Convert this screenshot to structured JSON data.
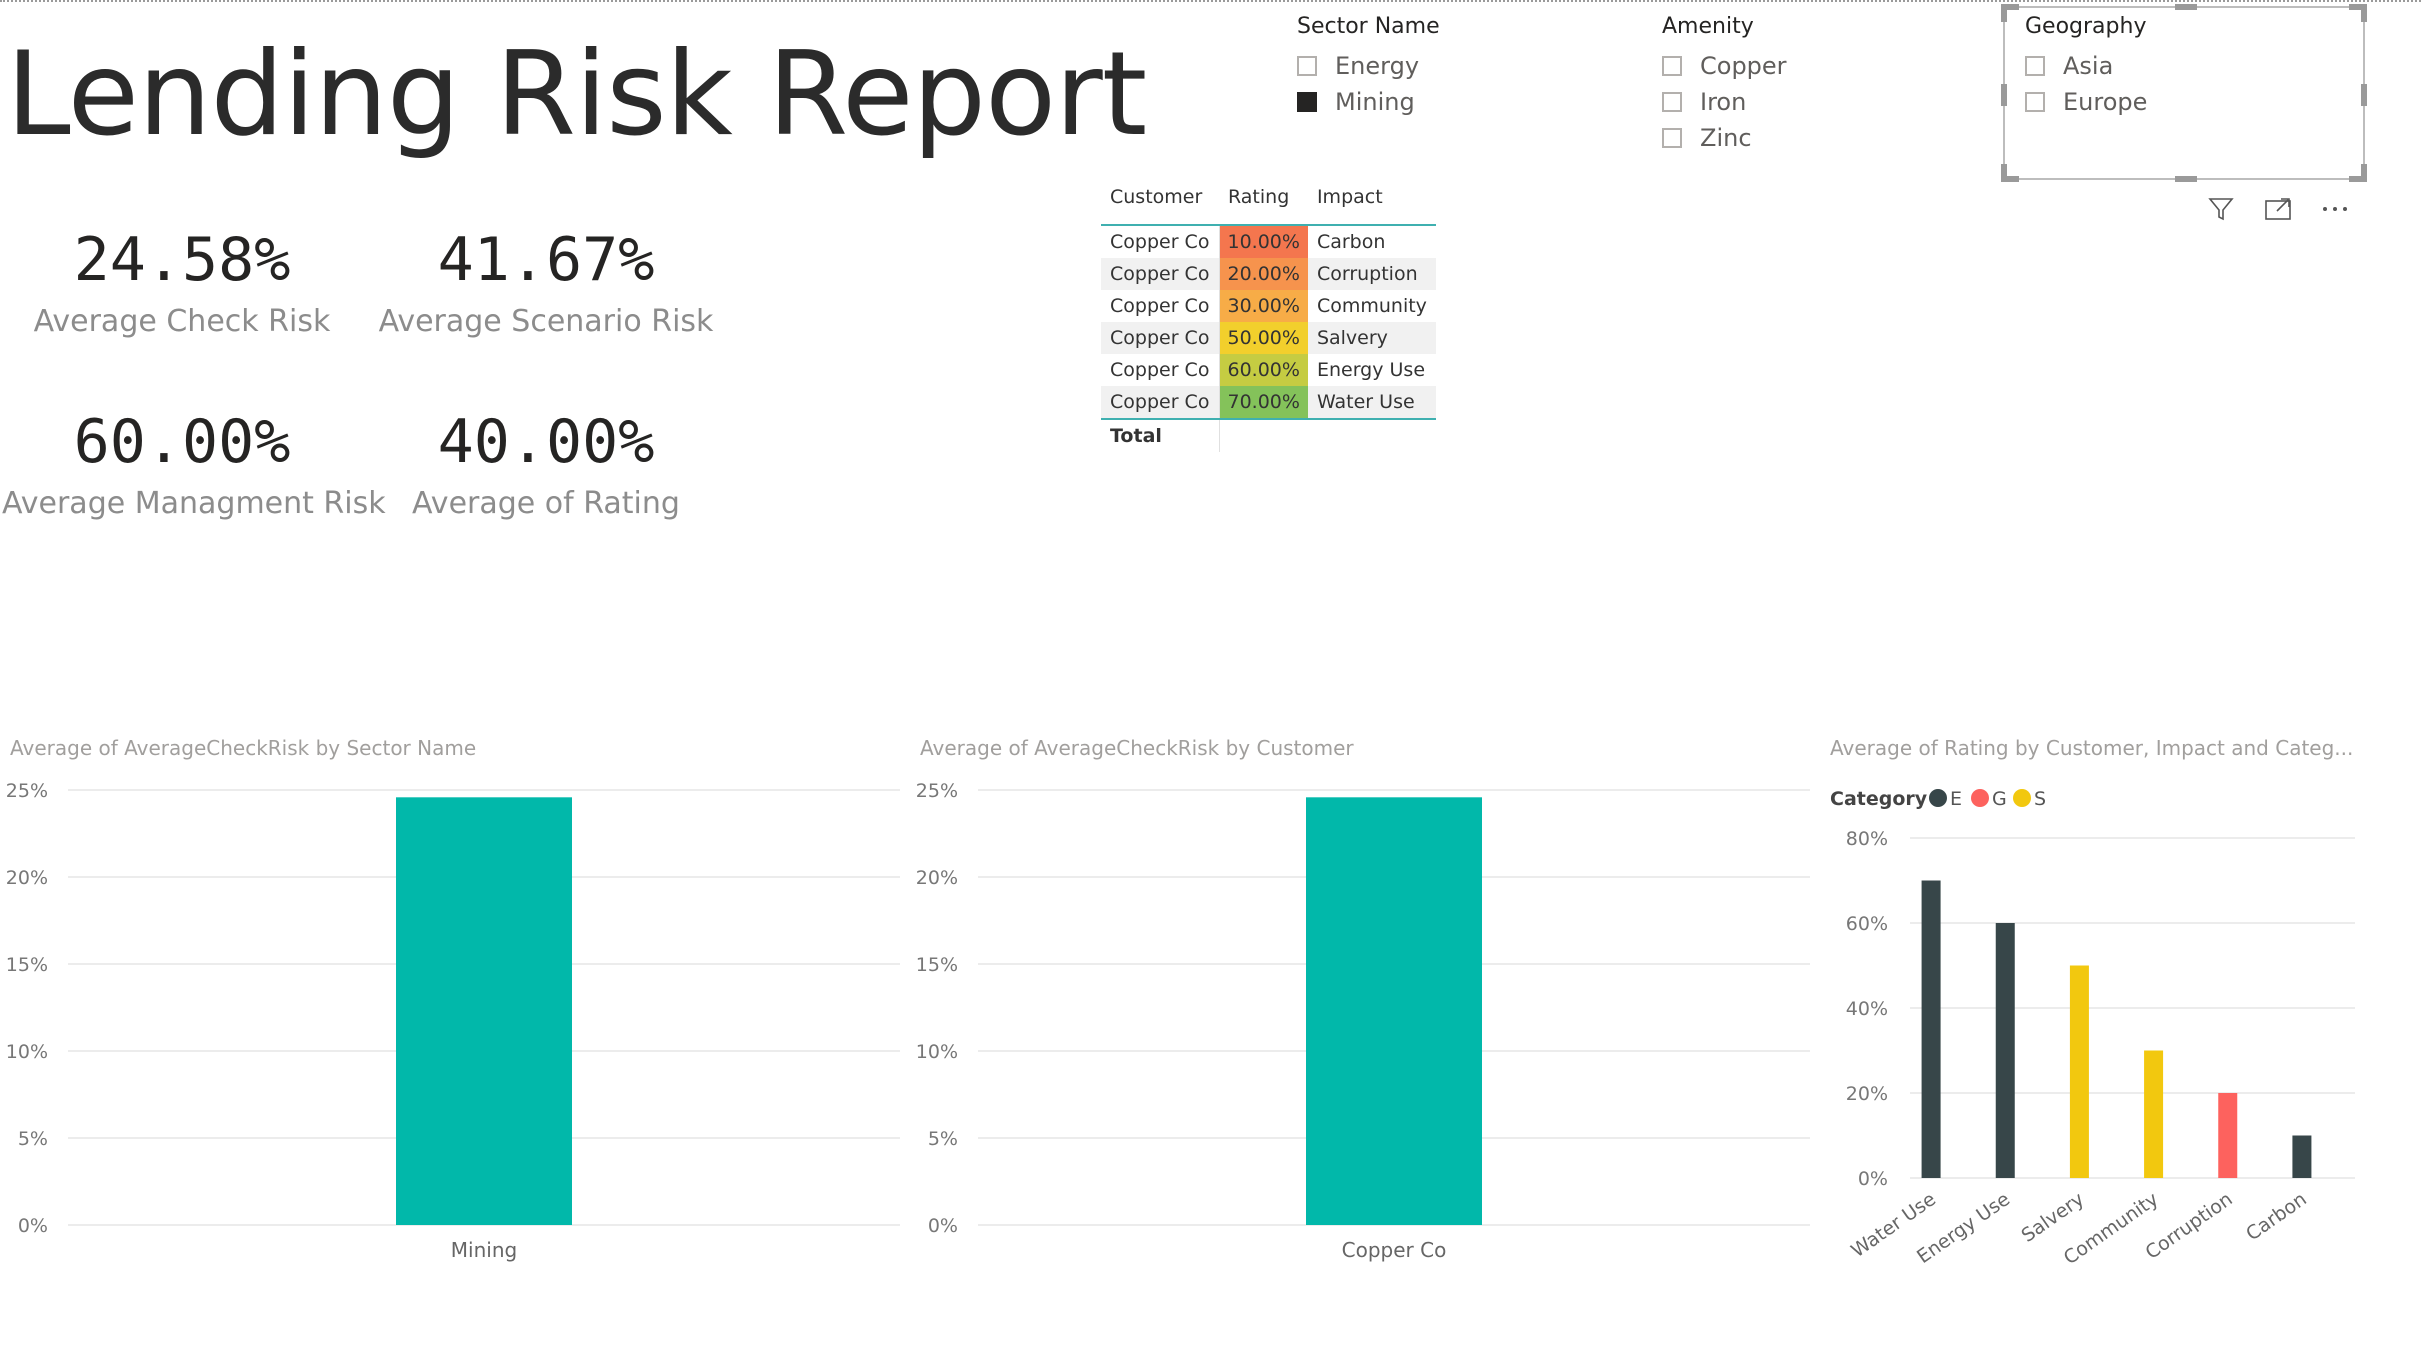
{
  "report": {
    "title": "Lending Risk Report"
  },
  "kpis": [
    {
      "value": "24.58%",
      "label": "Average Check Risk"
    },
    {
      "value": "41.67%",
      "label": "Average Scenario Risk"
    },
    {
      "value": "60.00%",
      "label": "Average Managment Risk"
    },
    {
      "value": "40.00%",
      "label": "Average of Rating"
    }
  ],
  "slicers": {
    "sector": {
      "title": "Sector Name",
      "items": [
        {
          "label": "Energy",
          "checked": false
        },
        {
          "label": "Mining",
          "checked": true
        }
      ]
    },
    "amenity": {
      "title": "Amenity",
      "items": [
        {
          "label": "Copper",
          "checked": false
        },
        {
          "label": "Iron",
          "checked": false
        },
        {
          "label": "Zinc",
          "checked": false
        }
      ]
    },
    "geography": {
      "title": "Geography",
      "items": [
        {
          "label": "Asia",
          "checked": false
        },
        {
          "label": "Europe",
          "checked": false
        }
      ]
    }
  },
  "visual_toolbar": {
    "icons": [
      "filter-icon",
      "focus-mode-icon",
      "more-options-icon"
    ]
  },
  "matrix": {
    "headers": [
      "Customer",
      "Rating",
      "Impact"
    ],
    "rows": [
      {
        "customer": "Copper Co",
        "rating": "10.00%",
        "impact": "Carbon",
        "color": "#f4764e"
      },
      {
        "customer": "Copper Co",
        "rating": "20.00%",
        "impact": "Corruption",
        "color": "#f6934d"
      },
      {
        "customer": "Copper Co",
        "rating": "30.00%",
        "impact": "Community",
        "color": "#f7ac47"
      },
      {
        "customer": "Copper Co",
        "rating": "50.00%",
        "impact": "Salvery",
        "color": "#f2cf2c"
      },
      {
        "customer": "Copper Co",
        "rating": "60.00%",
        "impact": "Energy Use",
        "color": "#c5cc42"
      },
      {
        "customer": "Copper Co",
        "rating": "70.00%",
        "impact": "Water Use",
        "color": "#84c25a"
      }
    ],
    "total_label": "Total"
  },
  "charts": [
    {
      "title": "Average of AverageCheckRisk by Sector Name",
      "chart_data": {
        "type": "bar",
        "categories": [
          "Mining"
        ],
        "values": [
          24.58
        ],
        "ylim": [
          0,
          25
        ],
        "yticks": [
          "25%",
          "20%",
          "15%",
          "10%",
          "5%",
          "0%"
        ],
        "grid": true,
        "color": "#01b8aa"
      }
    },
    {
      "title": "Average of AverageCheckRisk by Customer",
      "chart_data": {
        "type": "bar",
        "categories": [
          "Copper Co"
        ],
        "values": [
          24.58
        ],
        "ylim": [
          0,
          25
        ],
        "yticks": [
          "25%",
          "20%",
          "15%",
          "10%",
          "5%",
          "0%"
        ],
        "grid": true,
        "color": "#01b8aa"
      }
    },
    {
      "title": "Average of Rating by Customer, Impact and Categ...",
      "chart_data": {
        "type": "bar",
        "legend": {
          "title": "Category",
          "position": "top-left",
          "items": [
            {
              "name": "E",
              "color": "#374649"
            },
            {
              "name": "G",
              "color": "#fd625e"
            },
            {
              "name": "S",
              "color": "#f2c80f"
            }
          ]
        },
        "categories": [
          "Water Use",
          "Energy Use",
          "Salvery",
          "Community",
          "Corruption",
          "Carbon"
        ],
        "series": [
          {
            "name": "E",
            "values": [
              70,
              60,
              null,
              null,
              null,
              10
            ]
          },
          {
            "name": "G",
            "values": [
              null,
              null,
              null,
              null,
              20,
              null
            ]
          },
          {
            "name": "S",
            "values": [
              null,
              null,
              50,
              30,
              null,
              null
            ]
          }
        ],
        "ylim": [
          0,
          80
        ],
        "yticks": [
          "80%",
          "60%",
          "40%",
          "20%",
          "0%"
        ],
        "grid": true
      }
    }
  ]
}
